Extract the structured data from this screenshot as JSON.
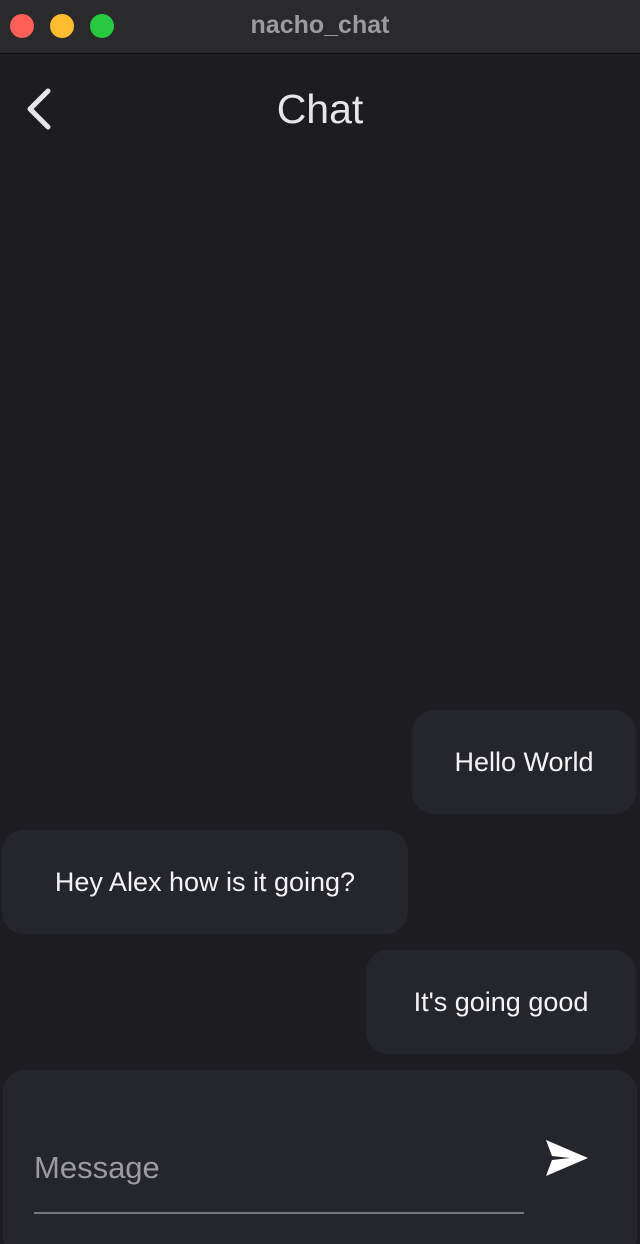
{
  "window": {
    "title": "nacho_chat"
  },
  "header": {
    "back_icon": "chevron-left-icon",
    "title": "Chat"
  },
  "messages": [
    {
      "text": "Hello World",
      "side": "right"
    },
    {
      "text": "Hey Alex how is it going?",
      "side": "left"
    },
    {
      "text": "It's going good",
      "side": "right"
    }
  ],
  "composer": {
    "placeholder": "Message",
    "value": "",
    "send_icon": "send-icon"
  },
  "colors": {
    "background": "#1c1c21",
    "bubble": "#25262b",
    "text": "#f3f3f5",
    "placeholder": "#9a9aa0",
    "close": "#ff5f57",
    "minimize": "#febc2e",
    "maximize": "#28c840"
  }
}
